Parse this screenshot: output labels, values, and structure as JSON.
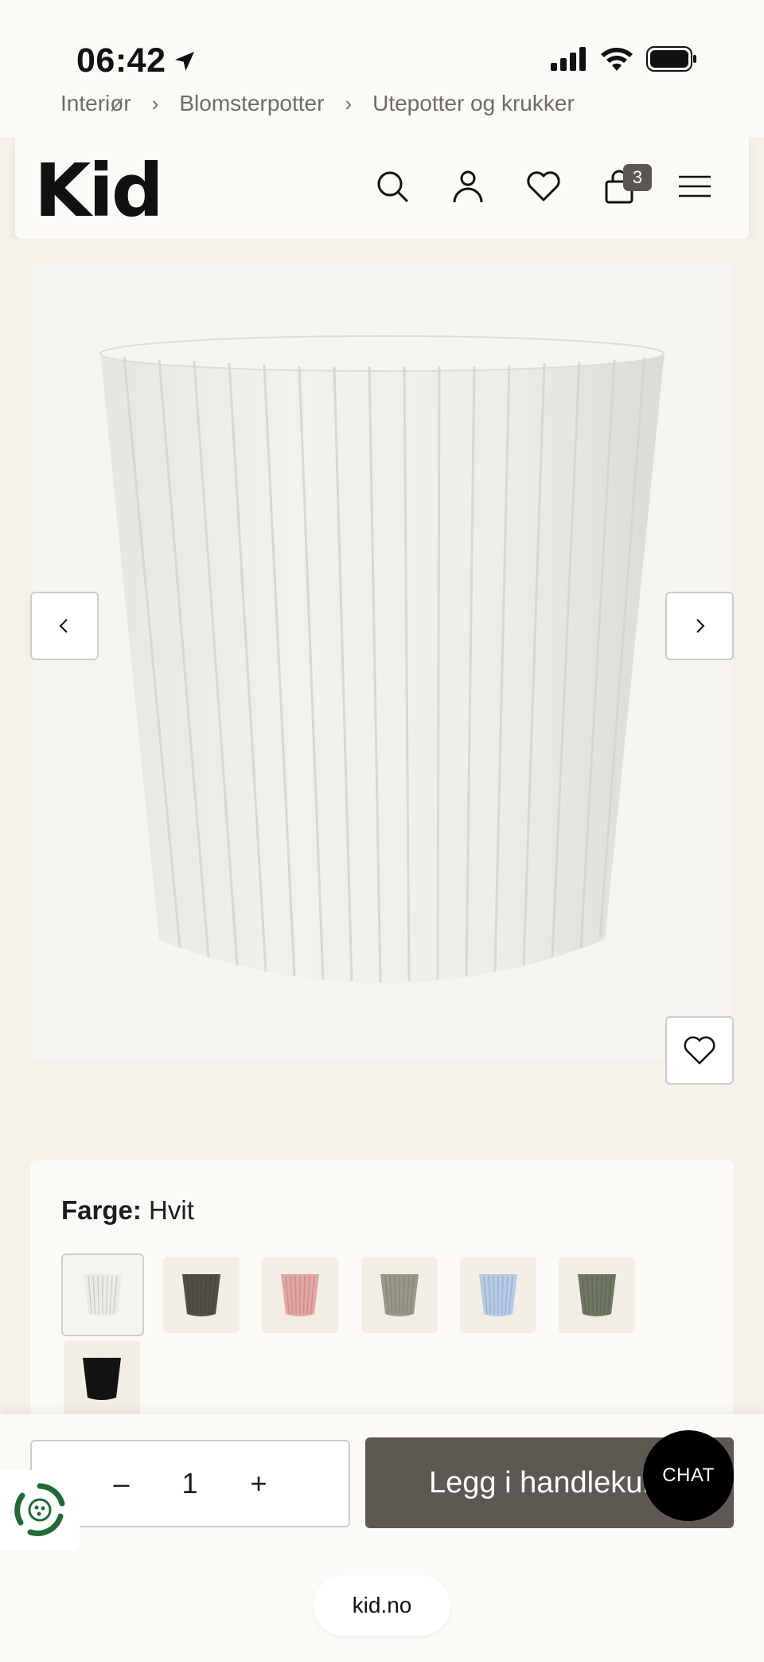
{
  "status_bar": {
    "time": "06:42"
  },
  "breadcrumb": {
    "items": [
      "Interiør",
      "Blomsterpotter",
      "Utepotter og krukker"
    ]
  },
  "header": {
    "logo": "Kid",
    "cart_count": "3",
    "icons": [
      "search-icon",
      "account-icon",
      "wishlist-heart-icon",
      "cart-bag-icon",
      "menu-icon"
    ]
  },
  "gallery": {
    "prev_icon": "chevron-left-icon",
    "next_icon": "chevron-right-icon",
    "favorite_icon": "heart-icon",
    "product_color_hex": "#f1f0ec"
  },
  "color_selector": {
    "label": "Farge:",
    "value": "Hvit",
    "swatches": [
      {
        "color": "#ecebe6",
        "selected": true
      },
      {
        "color": "#514e43",
        "selected": false
      },
      {
        "color": "#e3a6a2",
        "selected": false
      },
      {
        "color": "#9b988a",
        "selected": false
      },
      {
        "color": "#b7cbe6",
        "selected": false
      },
      {
        "color": "#6f7763",
        "selected": false
      },
      {
        "color": "#141414",
        "selected": false
      }
    ]
  },
  "purchase": {
    "minus_symbol": "–",
    "quantity": "1",
    "plus_symbol": "+",
    "add_to_cart_label": "Legg i handlekurv",
    "chat_label": "CHAT"
  },
  "browser": {
    "url": "kid.no"
  },
  "colors": {
    "accent_button": "#5e5852",
    "background": "#f4f1ea",
    "panel": "#fbfaf6"
  }
}
